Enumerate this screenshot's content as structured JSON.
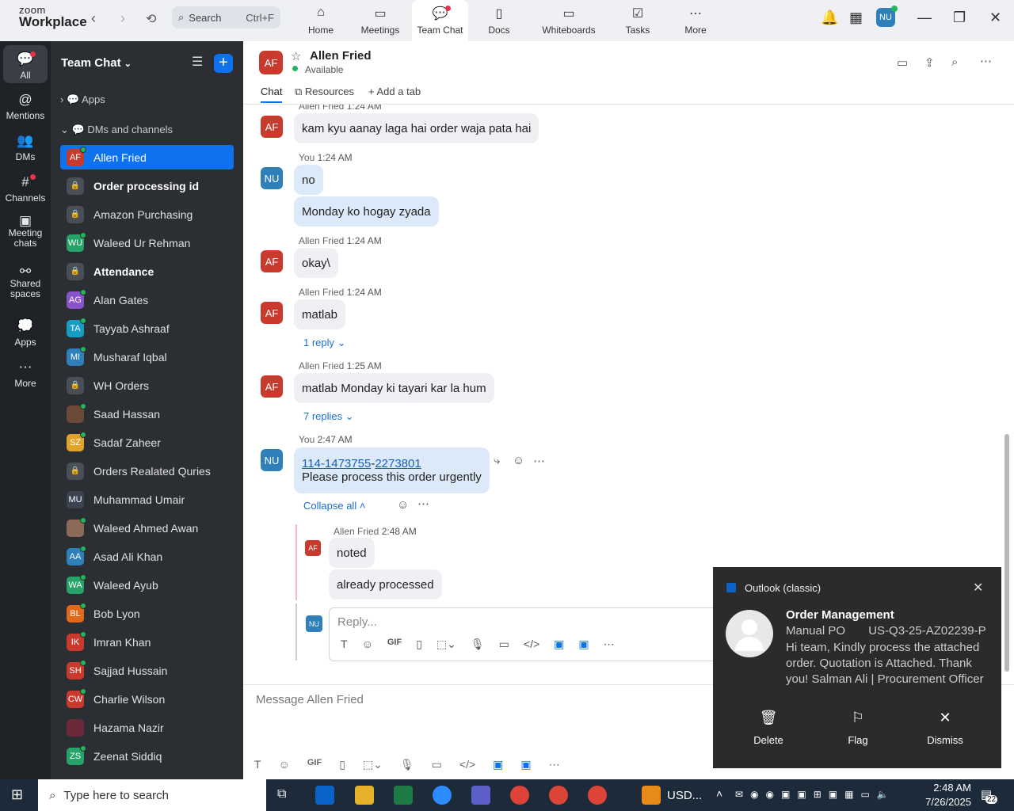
{
  "app": {
    "brand_top": "zoom",
    "brand_bottom": "Workplace"
  },
  "search": {
    "label": "Search",
    "shortcut": "Ctrl+F"
  },
  "tabs": [
    {
      "label": "Home",
      "icon": "home-icon"
    },
    {
      "label": "Meetings",
      "icon": "video-icon"
    },
    {
      "label": "Team Chat",
      "icon": "chat-icon"
    },
    {
      "label": "Docs",
      "icon": "doc-icon"
    },
    {
      "label": "Whiteboards",
      "icon": "whiteboard-icon"
    },
    {
      "label": "Tasks",
      "icon": "tasks-icon"
    },
    {
      "label": "More",
      "icon": "more-icon"
    }
  ],
  "profile": {
    "initials": "NU"
  },
  "rail": [
    {
      "label": "All"
    },
    {
      "label": "Mentions"
    },
    {
      "label": "DMs"
    },
    {
      "label": "Channels"
    },
    {
      "label": "Meeting chats"
    },
    {
      "label": "Shared spaces"
    },
    {
      "label": "Apps"
    },
    {
      "label": "More"
    }
  ],
  "sidebar": {
    "title": "Team Chat",
    "sections": {
      "apps": "Apps",
      "dms": "DMs and channels"
    },
    "items": [
      {
        "label": "Allen Fried",
        "initials": "AF",
        "color": "#c93a2e",
        "online": true
      },
      {
        "label": "Order processing id",
        "initials": "",
        "color": "#4a4e55",
        "lock": true,
        "bold": true
      },
      {
        "label": "Amazon Purchasing",
        "initials": "",
        "color": "#4a4e55",
        "lock": true
      },
      {
        "label": "Waleed Ur Rehman",
        "initials": "WU",
        "color": "#27a36a",
        "online": true
      },
      {
        "label": "Attendance",
        "initials": "",
        "color": "#4a4e55",
        "lock": true,
        "bold": true
      },
      {
        "label": "Alan Gates",
        "initials": "AG",
        "color": "#8a54c8",
        "online": true
      },
      {
        "label": "Tayyab Ashraaf",
        "initials": "TA",
        "color": "#1a9bc4",
        "online": true
      },
      {
        "label": "Musharaf Iqbal",
        "initials": "MI",
        "color": "#2f7fb8",
        "online": true
      },
      {
        "label": "WH Orders",
        "initials": "",
        "color": "#4a4e55",
        "lock": true
      },
      {
        "label": "Saad Hassan",
        "initials": "",
        "color": "#6b4a3a",
        "online": true
      },
      {
        "label": "Sadaf Zaheer",
        "initials": "SZ",
        "color": "#e0a42a",
        "online": true
      },
      {
        "label": "Orders Realated Quries",
        "initials": "",
        "color": "#4a4e55",
        "lock": true
      },
      {
        "label": "Muhammad Umair",
        "initials": "MU",
        "color": "#3b4250",
        "online": false
      },
      {
        "label": "Waleed Ahmed Awan",
        "initials": "",
        "color": "#8c6a5a",
        "online": true
      },
      {
        "label": "Asad Ali Khan",
        "initials": "AA",
        "color": "#2f7fb8",
        "online": true
      },
      {
        "label": "Waleed Ayub",
        "initials": "WA",
        "color": "#27a36a",
        "online": true
      },
      {
        "label": "Bob Lyon",
        "initials": "BL",
        "color": "#e06a1a",
        "online": true
      },
      {
        "label": "Imran Khan",
        "initials": "IK",
        "color": "#c93a2e",
        "online": true
      },
      {
        "label": "Sajjad Hussain",
        "initials": "SH",
        "color": "#c93a2e",
        "online": true
      },
      {
        "label": "Charlie Wilson",
        "initials": "CW",
        "color": "#c93a2e",
        "online": true
      },
      {
        "label": "Hazama Nazir",
        "initials": "",
        "color": "#6a2a3a",
        "online": false
      },
      {
        "label": "Zeenat Siddiq",
        "initials": "ZS",
        "color": "#27a36a",
        "online": true
      }
    ]
  },
  "chat": {
    "name": "Allen Fried",
    "initials": "AF",
    "status": "Available",
    "tabs": [
      "Chat",
      "Resources",
      "Add a tab"
    ],
    "messages": [
      {
        "sender": "Allen Fried",
        "time": "1:24 AM",
        "text": "kam kyu aanay laga hai order waja pata hai"
      },
      {
        "sender": "You",
        "time": "1:24 AM",
        "text": "no"
      },
      {
        "text": "Monday ko hogay zyada"
      },
      {
        "sender": "Allen Fried",
        "time": "1:24 AM",
        "text": "okay\\"
      },
      {
        "sender": "Allen Fried",
        "time": "1:24 AM",
        "text": "matlab",
        "replies": "1 reply"
      },
      {
        "sender": "Allen Fried",
        "time": "1:25 AM",
        "text": "matlab Monday ki tayari kar la hum",
        "replies": "7 replies"
      },
      {
        "sender": "You",
        "time": "2:47 AM",
        "link_a": "114-1473755",
        "link_sep": "-",
        "link_b": "2273801",
        "text": "Please process this order urgently"
      }
    ],
    "collapse": "Collapse all",
    "thread": {
      "sender": "Allen Fried",
      "time": "2:48 AM",
      "msg1": "noted",
      "msg2": "already processed"
    },
    "reply_placeholder": "Reply...",
    "composer_placeholder": "Message Allen Fried"
  },
  "toast": {
    "app": "Outlook (classic)",
    "title": "Order Management",
    "line1": "Manual PO       US-Q3-25-AZ02239-P",
    "body": "Hi team,  Kindly process the attached order. Quotation is Attached.  Thank you!  Salman Ali  | Procurement Officer",
    "actions": [
      "Delete",
      "Flag",
      "Dismiss"
    ]
  },
  "taskbar": {
    "search": "Type here to search",
    "time": "2:48 AM",
    "date": "7/26/2025",
    "notif": "22",
    "weather": "USD..."
  }
}
